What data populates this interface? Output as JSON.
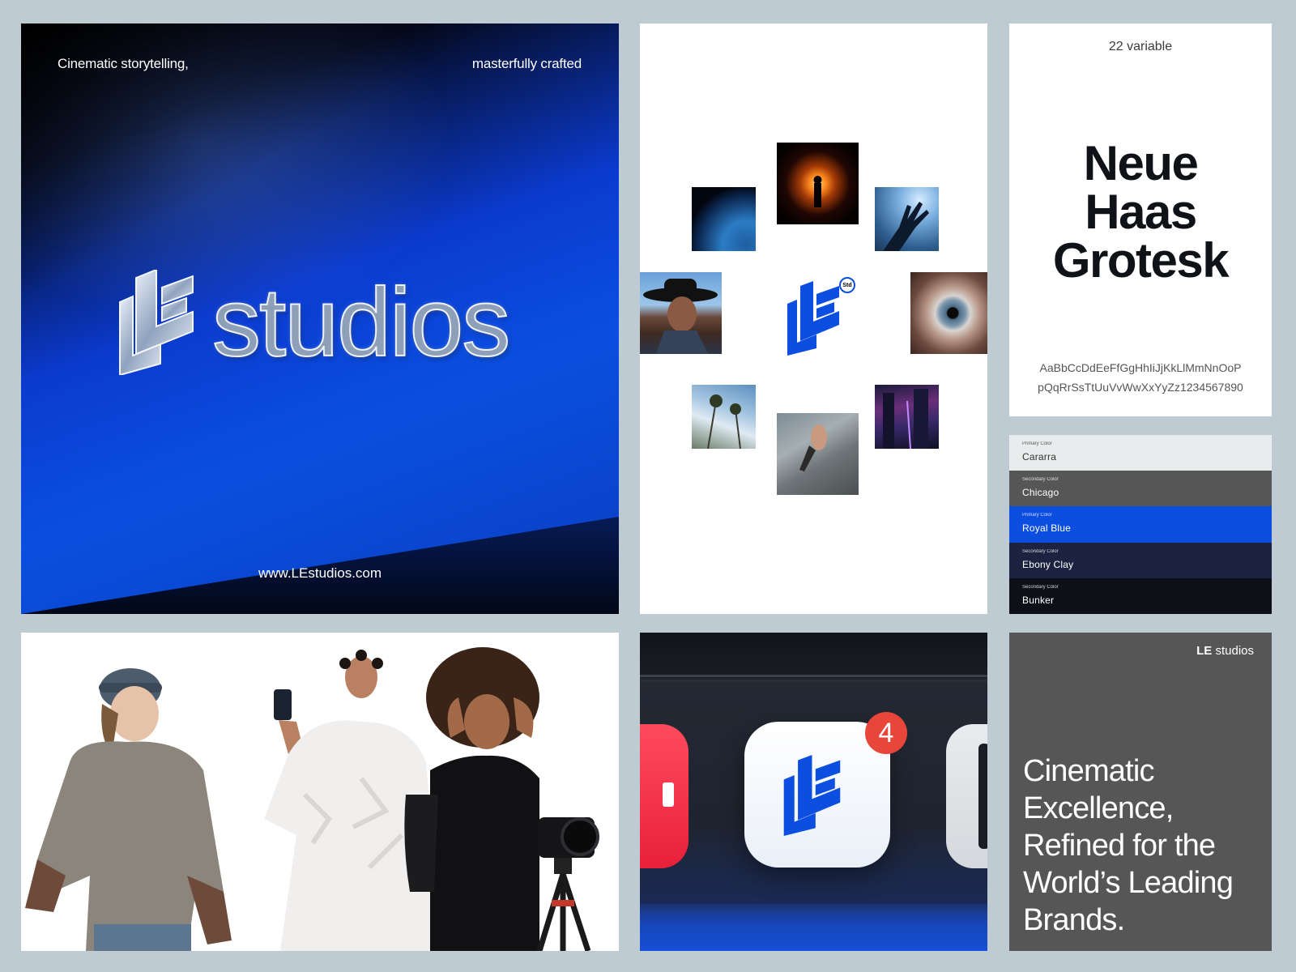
{
  "hero": {
    "tagline_left": "Cinematic storytelling,",
    "tagline_right": "masterfully crafted",
    "wordmark": "studios",
    "url": "www.LEstudios.com"
  },
  "moodboard": {
    "badge": "Std",
    "photos": [
      "earth-photo",
      "fire-photo",
      "hand-photo",
      "cowboy-photo",
      "eye-photo",
      "palms-photo",
      "climber-photo",
      "city-photo"
    ]
  },
  "typography": {
    "variable_label": "22 variable",
    "font_name_line1": "Neue",
    "font_name_line2": "Haas",
    "font_name_line3": "Grotesk",
    "specimen_line1": "AaBbCcDdEeFfGgHhIiJjKkLlMmNnOoP",
    "specimen_line2": "pQqRrSsTtUuVvWwXxYyZz1234567890"
  },
  "palette": [
    {
      "caption": "Primary Color",
      "name": "Cararra",
      "color": "#e9ecec",
      "text": "#333333"
    },
    {
      "caption": "Secondary Color",
      "name": "Chicago",
      "color": "#565656",
      "text": "#ffffff"
    },
    {
      "caption": "Primary Color",
      "name": "Royal Blue",
      "color": "#0b4ee0",
      "text": "#ffffff"
    },
    {
      "caption": "Secondary Color",
      "name": "Ebony Clay",
      "color": "#1b2340",
      "text": "#ffffff"
    },
    {
      "caption": "Secondary Color",
      "name": "Bunker",
      "color": "#0d1117",
      "text": "#ffffff"
    }
  ],
  "dock": {
    "badge_count": "4"
  },
  "tagline": {
    "brand_bold": "LE",
    "brand_rest": " studios",
    "headline": "Cinematic Excellence, Refined for the World’s Leading Brands."
  },
  "colors": {
    "brand_blue": "#0b4ee0",
    "background": "#bfcbd3"
  }
}
